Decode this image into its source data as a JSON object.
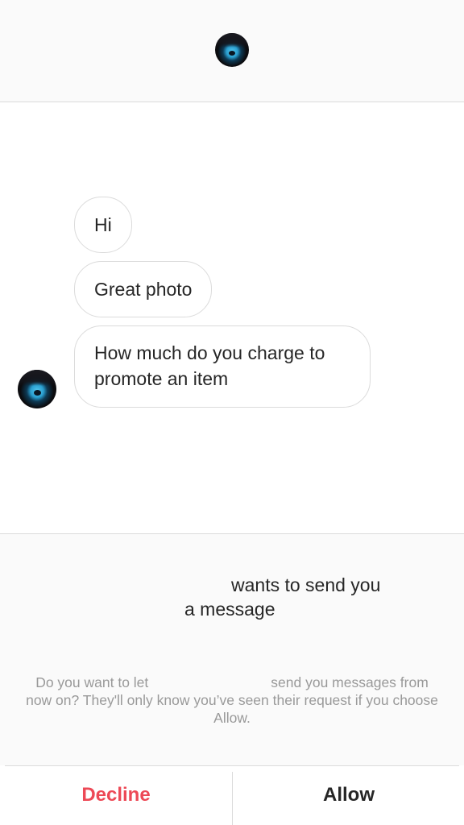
{
  "header": {
    "avatar_icon": "profile-avatar-icon"
  },
  "thread": {
    "messages": [
      {
        "text": "Hi"
      },
      {
        "text": "Great photo"
      },
      {
        "text": "How much do you charge to promote an item"
      }
    ],
    "sender_avatar_icon": "profile-avatar-icon"
  },
  "request": {
    "line1": "wants to send you",
    "line2": "a message",
    "desc_part1": "Do you want to let",
    "desc_part2": "send you messages from now on? They'll only know you’ve seen their request if you choose Allow."
  },
  "actions": {
    "decline_label": "Decline",
    "allow_label": "Allow"
  },
  "colors": {
    "decline": "#ed4956",
    "text": "#262626",
    "muted": "#999999",
    "border": "#dbdbdb",
    "panel_bg": "#fafafa"
  }
}
